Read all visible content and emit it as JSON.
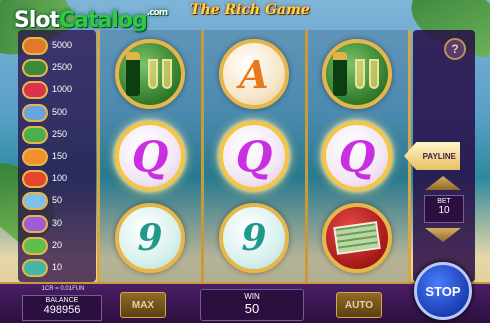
{
  "header": {
    "title": "The Rich Game"
  },
  "watermark": {
    "main": "Slot",
    "accent": "Catalog",
    "tld": ".com"
  },
  "paytable": [
    {
      "value": "5000",
      "symbol": "cash-stack-icon",
      "color": "#e07a2a"
    },
    {
      "value": "2500",
      "symbol": "champagne-icon",
      "color": "#3b8a3a"
    },
    {
      "value": "1000",
      "symbol": "heart-icon",
      "color": "#d9344a"
    },
    {
      "value": "500",
      "symbol": "diamond-icon",
      "color": "#6aa4e0"
    },
    {
      "value": "250",
      "symbol": "gem-icon",
      "color": "#4bb04b"
    },
    {
      "value": "150",
      "symbol": "ace-icon",
      "color": "#f0912e"
    },
    {
      "value": "100",
      "symbol": "king-icon",
      "color": "#e6462e"
    },
    {
      "value": "50",
      "symbol": "queen-icon",
      "color": "#7fc0ea"
    },
    {
      "value": "30",
      "symbol": "jack-icon",
      "color": "#9e5cd6"
    },
    {
      "value": "20",
      "symbol": "ten-icon",
      "color": "#5fbf4a"
    },
    {
      "value": "10",
      "symbol": "nine-icon",
      "color": "#44b7a8"
    }
  ],
  "reels": [
    [
      {
        "type": "bottle"
      },
      {
        "type": "q",
        "label": "Q"
      },
      {
        "type": "nine",
        "label": "9"
      }
    ],
    [
      {
        "type": "a",
        "label": "A"
      },
      {
        "type": "q",
        "label": "Q"
      },
      {
        "type": "nine",
        "label": "9"
      }
    ],
    [
      {
        "type": "bottle"
      },
      {
        "type": "q",
        "label": "Q"
      },
      {
        "type": "cash"
      }
    ]
  ],
  "controls": {
    "help": "?",
    "payline": "PAYLINE",
    "bet_label": "BET",
    "bet_value": "10",
    "rate": "1CR = 0.01FUN",
    "balance_label": "BALANCE",
    "balance_value": "498956",
    "max_label": "MAX",
    "win_label": "WIN",
    "win_value": "50",
    "auto_label": "AUTO",
    "stop_label": "STOP"
  }
}
